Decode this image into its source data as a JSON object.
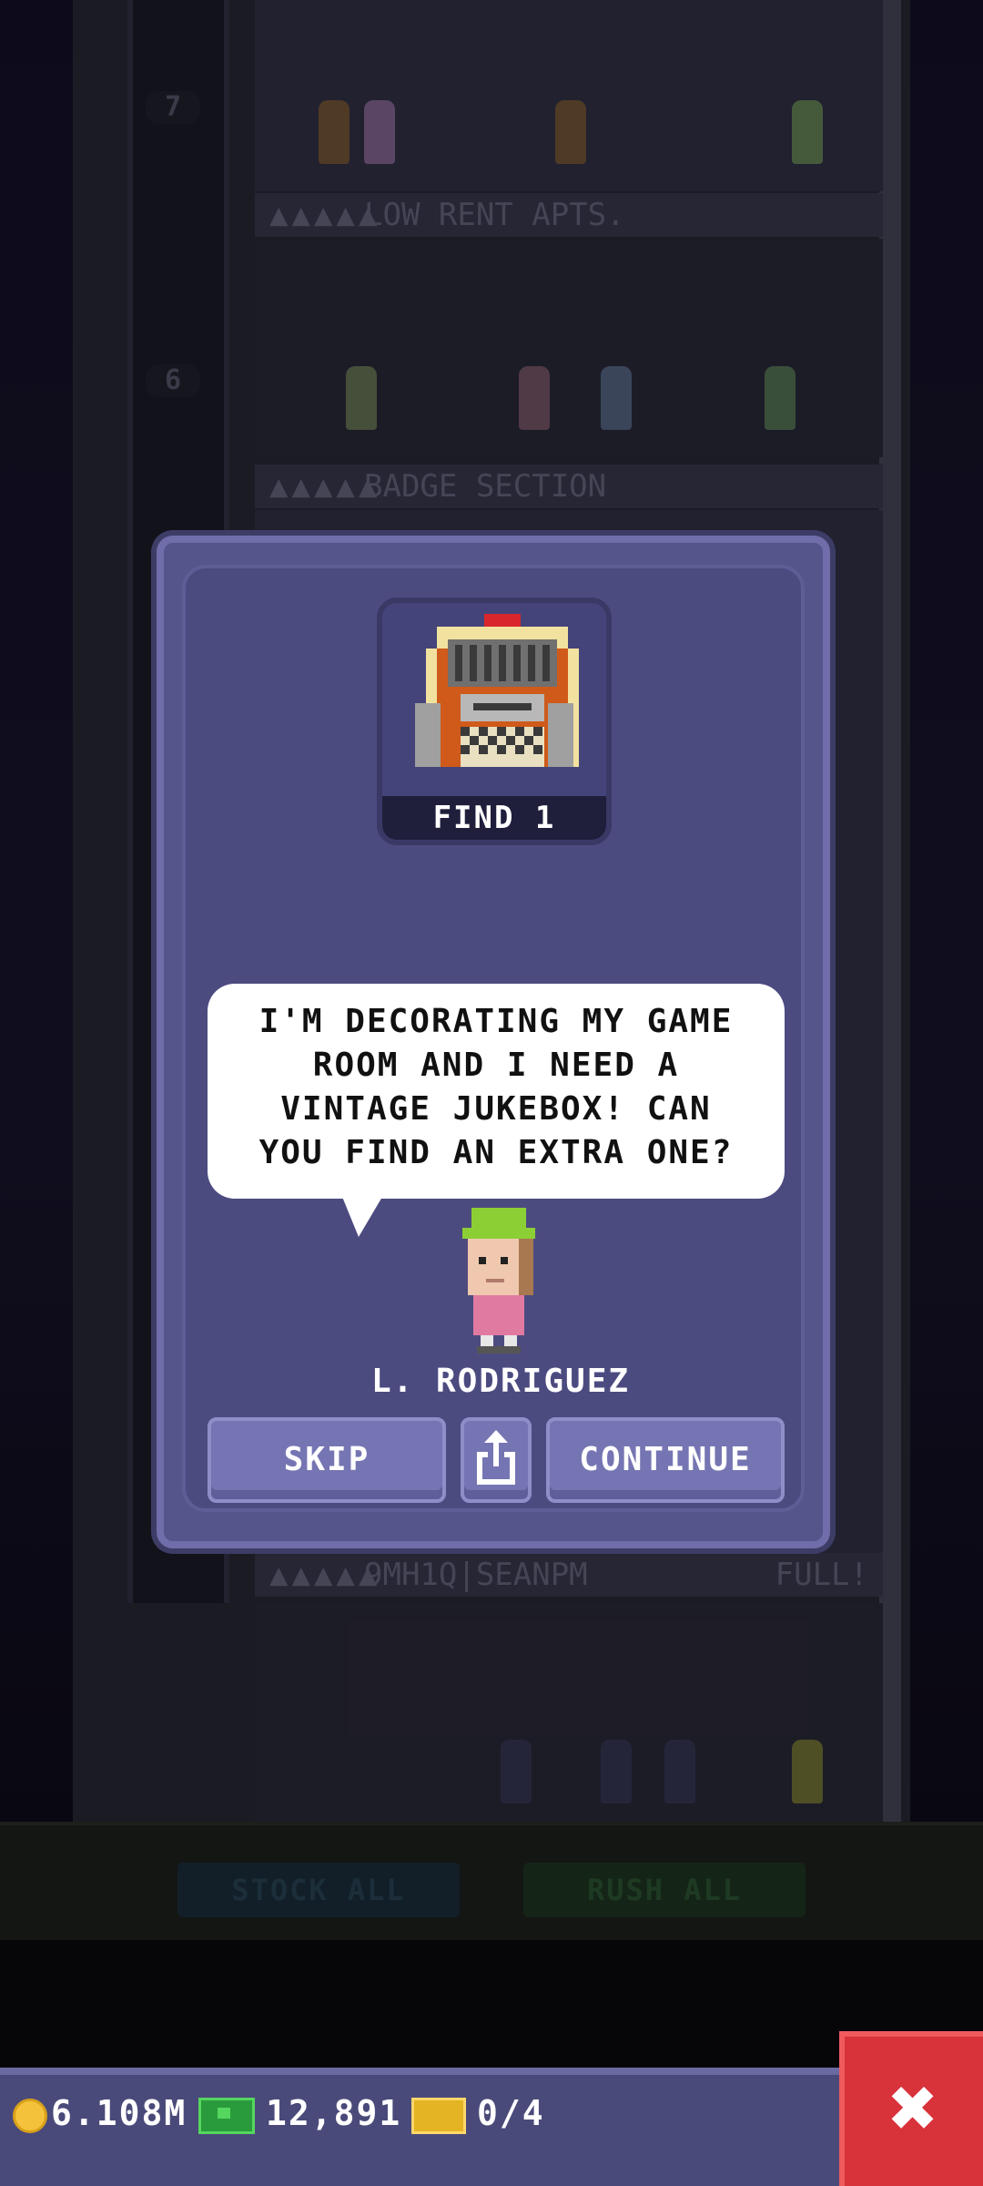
{
  "background": {
    "floors": [
      {
        "label": "LOW RENT APTS.",
        "status": ""
      },
      {
        "label": "BADGE SECTION",
        "status": ""
      },
      {
        "label": "9MH1Q|SEANPM",
        "status": "FULL!"
      }
    ],
    "shaft_numbers": [
      "7",
      "6"
    ],
    "ground_buttons": {
      "stock": "STOCK ALL",
      "rush": "RUSH ALL"
    },
    "floor_dots": "▲▲▲▲▲"
  },
  "dialog": {
    "item_icon": "jukebox-icon",
    "find_label": "FIND 1",
    "speech": "I'M DECORATING MY GAME ROOM AND I NEED A VINTAGE JUKEBOX! CAN YOU FIND AN EXTRA ONE?",
    "person_name": "L. RODRIGUEZ",
    "buttons": {
      "skip": "SKIP",
      "continue": "CONTINUE"
    },
    "share_icon": "share-icon"
  },
  "hud": {
    "coins": "6.108M",
    "bux": "12,891",
    "tickets": "0/4",
    "close_icon": "close-icon"
  },
  "colors": {
    "dialog_bg": "#55548b",
    "button": "#7675b3",
    "hud": "#4a4a7a",
    "close": "#d8323a",
    "coin": "#f5c33b",
    "bux": "#2a9b3c",
    "ticket": "#e4b424"
  }
}
